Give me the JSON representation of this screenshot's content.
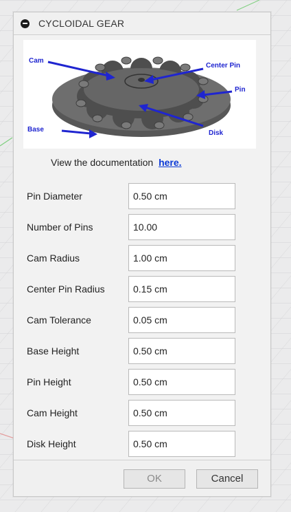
{
  "dialog": {
    "title": "CYCLOIDAL GEAR",
    "figure": {
      "callouts": {
        "cam": "Cam",
        "center_pin": "Center Pin",
        "pin": "Pin",
        "base": "Base",
        "disk": "Disk"
      },
      "colors": {
        "callout": "#1f25d0",
        "gear": "#6e6e6e"
      }
    },
    "doc_text": "View the documentation",
    "doc_link": "here.",
    "fields": [
      {
        "label": "Pin Diameter",
        "value": "0.50 cm"
      },
      {
        "label": "Number of Pins",
        "value": "10.00"
      },
      {
        "label": "Cam Radius",
        "value": "1.00 cm"
      },
      {
        "label": "Center Pin Radius",
        "value": "0.15 cm"
      },
      {
        "label": "Cam Tolerance",
        "value": "0.05 cm"
      },
      {
        "label": "Base Height",
        "value": "0.50 cm"
      },
      {
        "label": "Pin Height",
        "value": "0.50 cm"
      },
      {
        "label": "Cam Height",
        "value": "0.50 cm"
      },
      {
        "label": "Disk Height",
        "value": "0.50 cm"
      }
    ],
    "ok_label": "OK",
    "cancel_label": "Cancel"
  }
}
